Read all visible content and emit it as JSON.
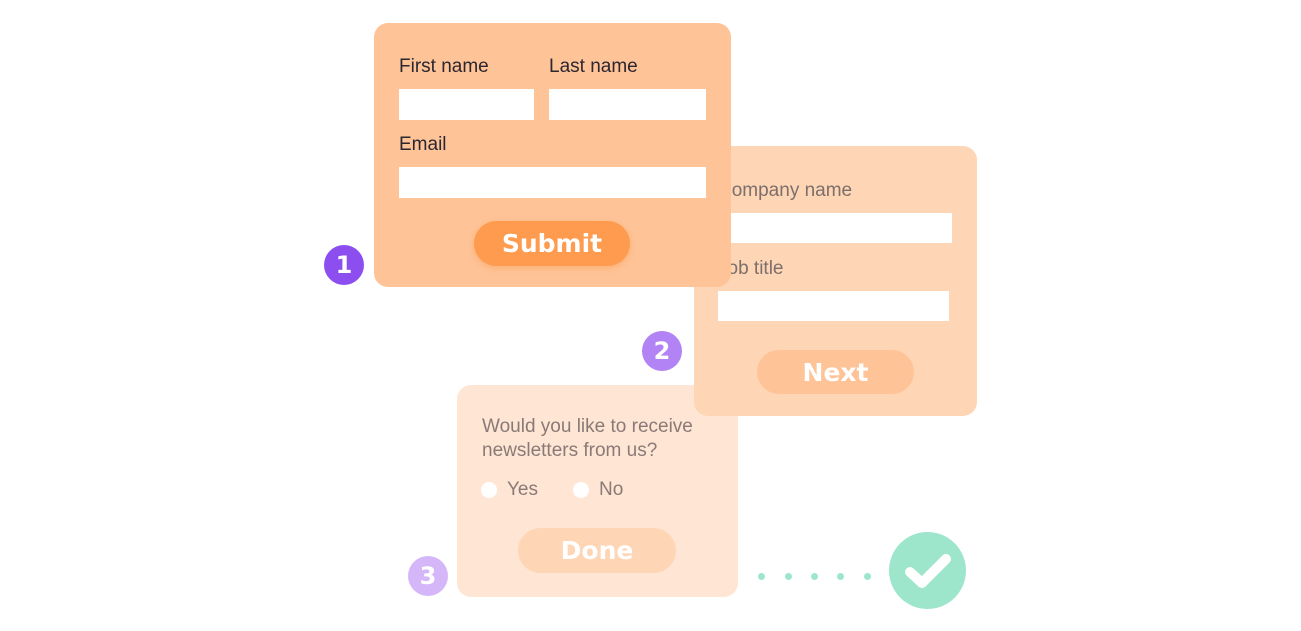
{
  "step1": {
    "badge": "1",
    "first_name_label": "First name",
    "last_name_label": "Last name",
    "email_label": "Email",
    "first_name_value": "",
    "last_name_value": "",
    "email_value": "",
    "submit_label": "Submit"
  },
  "step2": {
    "badge": "2",
    "company_label": "Company name",
    "job_title_label": "Job title",
    "company_value": "",
    "job_title_value": "",
    "next_label": "Next"
  },
  "step3": {
    "badge": "3",
    "question": "Would you like to receive newsletters from us?",
    "options": [
      "Yes",
      "No"
    ],
    "done_label": "Done"
  },
  "completion": {
    "icon": "checkmark-icon"
  },
  "colors": {
    "card1": "#fec397",
    "card2": "#fed6b5",
    "card3": "#ffe5d4",
    "submit": "#fe9b4e",
    "badge1": "#8d4ef0",
    "badge2": "#b283f4",
    "badge3": "#d5b7f9",
    "success": "#9de6cc"
  }
}
